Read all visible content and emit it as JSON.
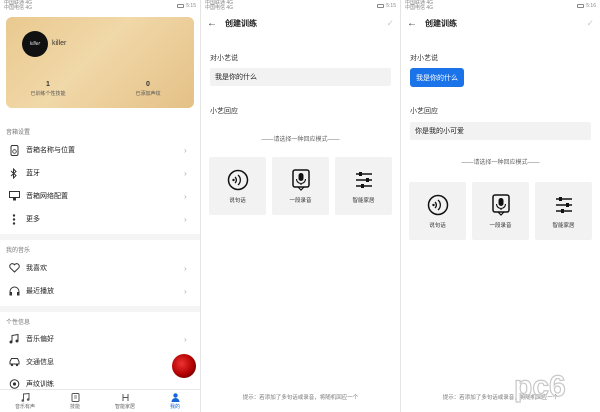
{
  "status": {
    "left1": "中国联通 4G",
    "left2": "中国电信 4G",
    "time1": "5:15",
    "time2": "5:15",
    "time3": "5:16"
  },
  "profile": {
    "avatar_text": "killer",
    "username": "killer",
    "stats": [
      {
        "num": "1",
        "label": "已训练个性技能"
      },
      {
        "num": "0",
        "label": "已添加声纹"
      }
    ]
  },
  "sections": {
    "speaker": "音箱设置",
    "music": "我的音乐",
    "personal": "个性信息"
  },
  "menu": {
    "speaker_items": [
      "音箱名称与位置",
      "蓝牙",
      "音箱网络配置",
      "更多"
    ],
    "music_items": [
      "我喜欢",
      "最近播放"
    ],
    "personal_items": [
      "音乐偏好",
      "交通信息",
      "声纹训练"
    ]
  },
  "tabs": [
    "音乐有声",
    "技能",
    "智能家居",
    "我的"
  ],
  "training": {
    "title": "创建训练",
    "to_xiaoyi": "对小艺说",
    "phrase": "我是你的什么",
    "reply_label": "小艺回应",
    "reply_text": "你是我的小可爱",
    "mode_hint": "——请选择一种回应模式——",
    "modes": [
      "说句话",
      "一段录音",
      "智能家居"
    ],
    "footer": "提示：若添加了多句话或录音，将随机回应一个"
  },
  "watermark": "pc6",
  "colors": {
    "accent": "#1a73e8",
    "card": "#edd09b"
  }
}
